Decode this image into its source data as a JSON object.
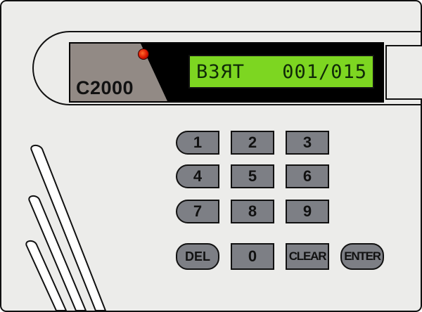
{
  "colors": {
    "body": "#ececea",
    "outline": "#111111",
    "display_frame": "#000000",
    "lcd": "#7dd621",
    "led": "#d81400",
    "key": "#7d7f85",
    "logo_plate": "#928a85"
  },
  "brand": {
    "logo": "C2000"
  },
  "display": {
    "mode": "ВЗЯТ",
    "counter": "001/015"
  },
  "keypad": {
    "k1": "1",
    "k2": "2",
    "k3": "3",
    "k4": "4",
    "k5": "5",
    "k6": "6",
    "k7": "7",
    "k8": "8",
    "k9": "9",
    "del": "DEL",
    "k0": "0",
    "clear": "CLEAR",
    "enter": "ENTER"
  }
}
